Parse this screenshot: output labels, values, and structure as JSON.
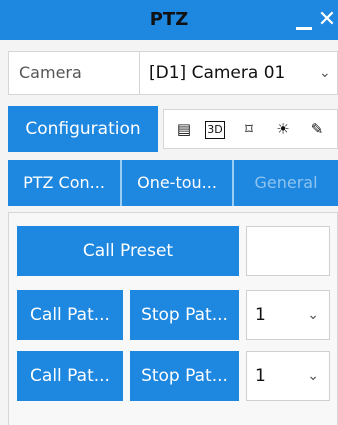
{
  "window": {
    "title": "PTZ",
    "minimize_icon": "minimize-icon",
    "close_icon": "close-icon",
    "close_glyph": "✕"
  },
  "camera": {
    "label": "Camera",
    "selected": "[D1] Camera 01",
    "chevron": "⌄"
  },
  "toolbar": {
    "config_label": "Configuration",
    "tools": [
      {
        "icon": "list-icon",
        "glyph": "▤"
      },
      {
        "icon": "3d-icon",
        "glyph": "3D"
      },
      {
        "icon": "focus-frame-icon",
        "glyph": "⌑"
      },
      {
        "icon": "light-icon",
        "glyph": "☀"
      },
      {
        "icon": "wiper-icon",
        "glyph": "✎"
      }
    ]
  },
  "tabs": [
    {
      "label": "PTZ Con..."
    },
    {
      "label": "One-tou..."
    },
    {
      "label": "General"
    }
  ],
  "panel": {
    "call_preset": "Call Preset",
    "preset_value": "",
    "rows": [
      {
        "call": "Call Pat...",
        "stop": "Stop Pat...",
        "value": "1"
      },
      {
        "call": "Call Pat...",
        "stop": "Stop Pat...",
        "value": "1"
      }
    ],
    "chevron": "⌄"
  }
}
